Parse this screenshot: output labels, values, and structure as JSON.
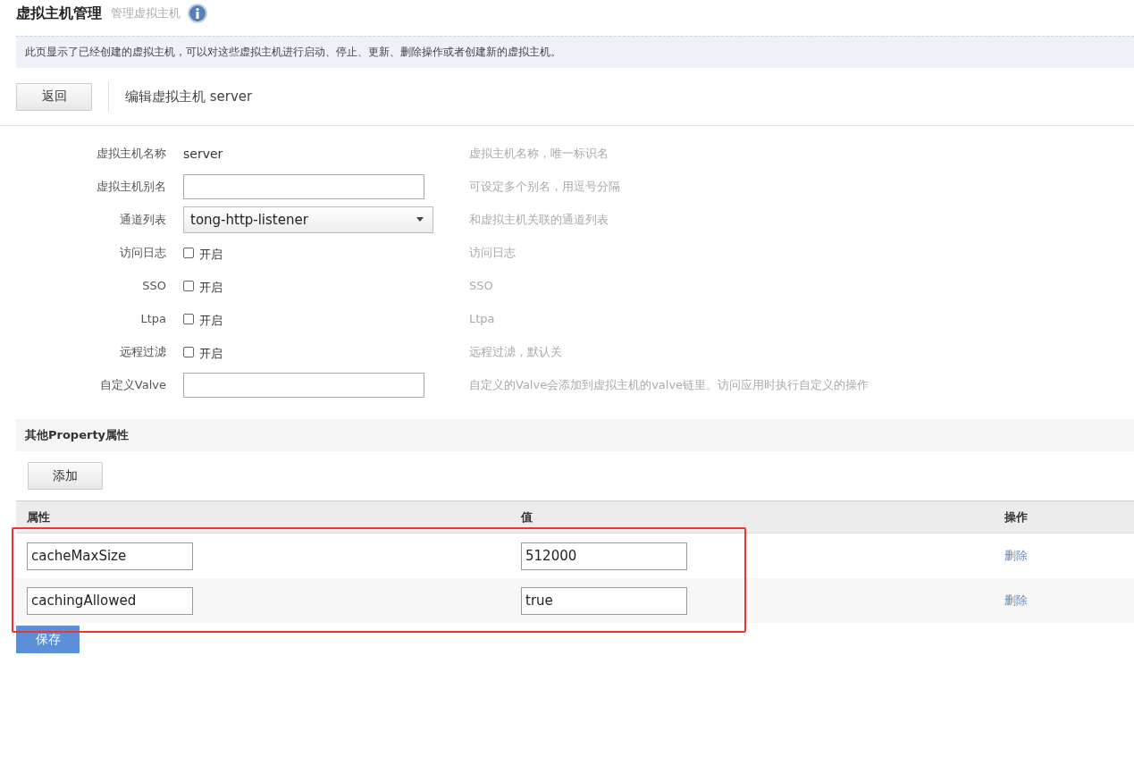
{
  "header": {
    "title": "虚拟主机管理",
    "subtitle": "管理虚拟主机"
  },
  "info_bar": "此页显示了已经创建的虚拟主机，可以对这些虚拟主机进行启动、停止、更新、删除操作或者创建新的虚拟主机。",
  "toolbar": {
    "back_button": "返回",
    "heading": "编辑虚拟主机 server"
  },
  "form": [
    {
      "kind": "text",
      "label": "虚拟主机名称",
      "value": "server",
      "hint": "虚拟主机名称，唯一标识名"
    },
    {
      "kind": "input",
      "label": "虚拟主机别名",
      "hint": "可设定多个别名，用逗号分隔"
    },
    {
      "kind": "select",
      "label": "通道列表",
      "value": "tong-http-listener",
      "hint": "和虚拟主机关联的通道列表"
    },
    {
      "kind": "checkbox",
      "label": "访问日志",
      "option": "开启",
      "checked": false,
      "hint": "访问日志"
    },
    {
      "kind": "checkbox",
      "label": "SSO",
      "option": "开启",
      "checked": false,
      "hint": "SSO"
    },
    {
      "kind": "checkbox",
      "label": "Ltpa",
      "option": "开启",
      "checked": false,
      "hint": "Ltpa"
    },
    {
      "kind": "checkbox",
      "label": "远程过滤",
      "option": "开启",
      "checked": false,
      "hint": "远程过滤，默认关"
    },
    {
      "kind": "input",
      "label": "自定义Valve",
      "hint": "自定义的Valve会添加到虚拟主机的valve链里。访问应用时执行自定义的操作"
    }
  ],
  "property_section": {
    "title": "其他Property属性",
    "add_button": "添加",
    "table": {
      "columns": [
        "属性",
        "值",
        "操作"
      ],
      "rows": [
        {
          "name": "cacheMaxSize",
          "value": "512000",
          "action": "删除"
        },
        {
          "name": "cachingAllowed",
          "value": "true",
          "action": "删除"
        }
      ]
    }
  },
  "save_button": "保存"
}
